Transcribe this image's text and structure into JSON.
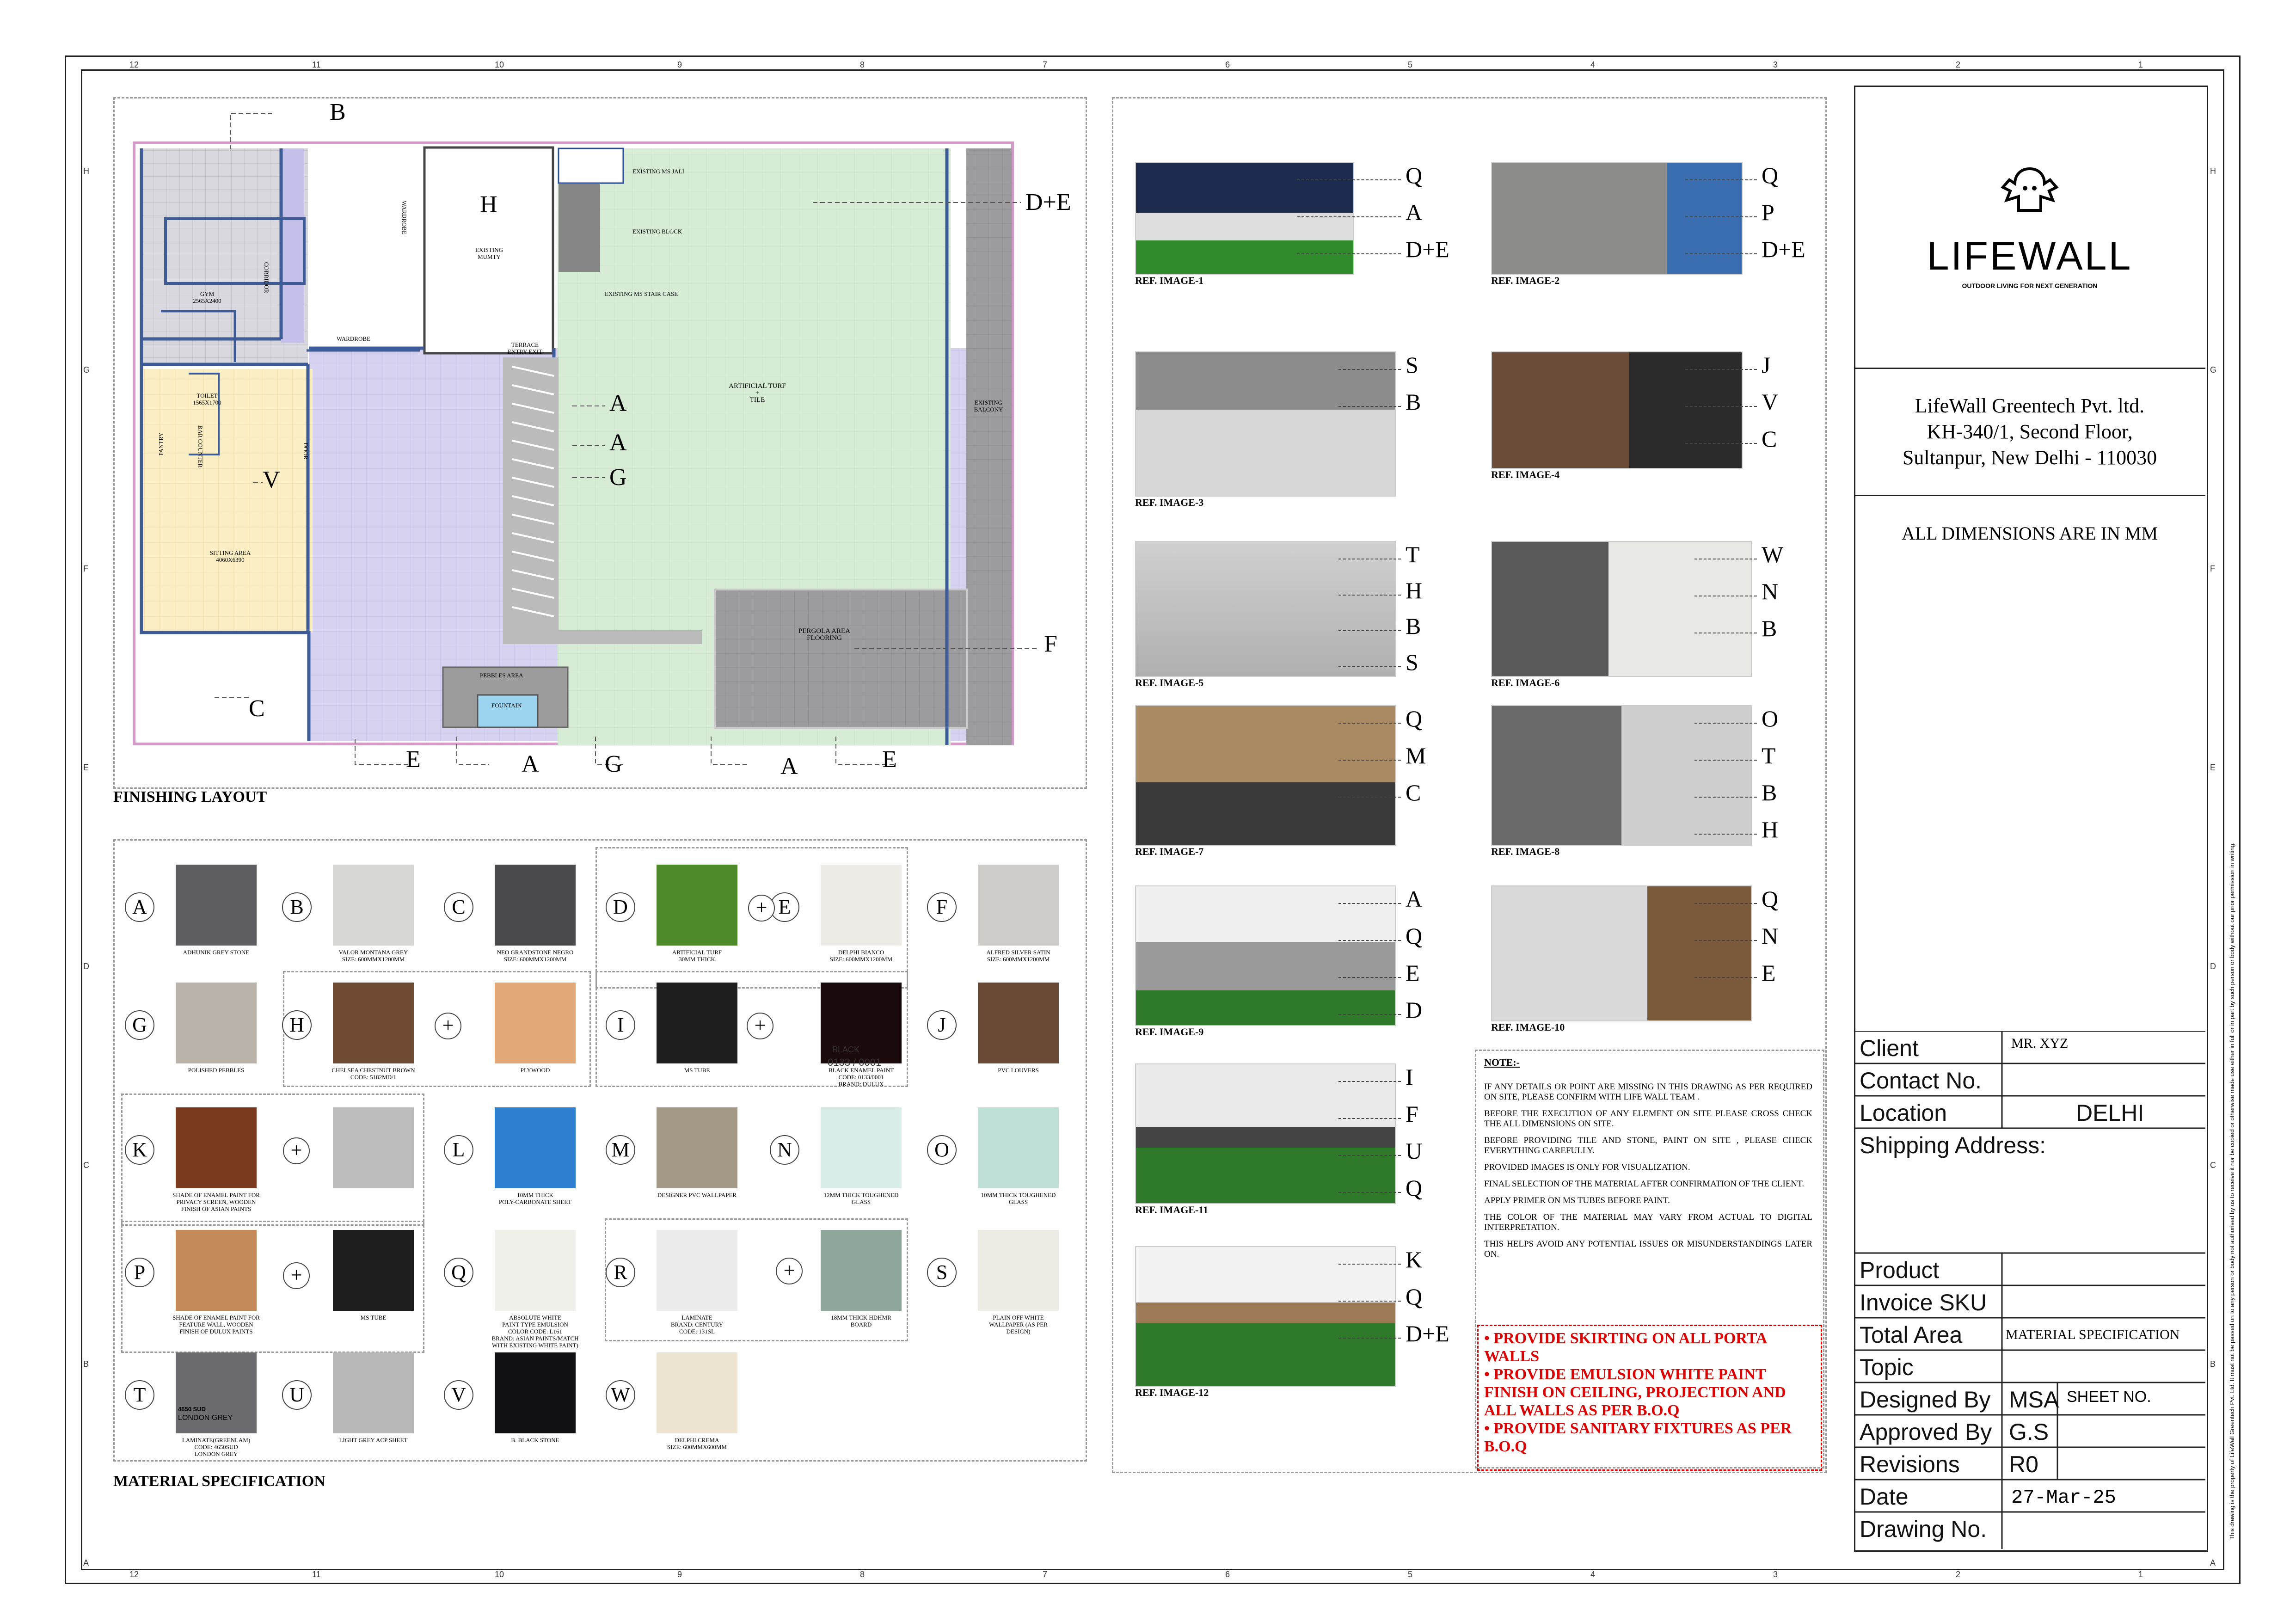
{
  "ruler": {
    "cols": [
      "12",
      "11",
      "10",
      "9",
      "8",
      "7",
      "6",
      "5",
      "4",
      "3",
      "2",
      "1"
    ],
    "rows": [
      "H",
      "G",
      "F",
      "E",
      "D",
      "C",
      "B",
      "A"
    ]
  },
  "plan": {
    "title": "FINISHING LAYOUT",
    "markers": [
      "B",
      "H",
      "D+E",
      "A",
      "A",
      "G",
      "V",
      "C",
      "F",
      "E",
      "A",
      "G",
      "A",
      "E"
    ],
    "rooms": {
      "gym": "GYM\n2565X2400",
      "corridor": "CORRIDOR",
      "wardrobe_v": "WARDROBE",
      "wardrobe_h": "WARDROBE",
      "toilet": "TOILET\n1565X1700",
      "mumty": "EXISTING\nMUMTY",
      "jali": "EXISTING MS JALI",
      "block": "EXISTING BLOCK",
      "stair": "EXISTING MS STAIR CASE",
      "terrace": "TERRACE\nENTRY EXIT",
      "turf": "ARTIFICIAL TURF\n+\nTILE",
      "balcony": "EXISTING\nBALCONY",
      "pantry": "PANTRY",
      "bar": "BAR COUNTER",
      "door": "DOOR",
      "sitting": "SITTING AREA\n4060X6390",
      "pergola": "PERGOLA AREA\nFLOORING",
      "pebbles": "PEBBLES AREA",
      "fountain": "FOUNTAIN"
    }
  },
  "materials": {
    "title": "MATERIAL SPECIFICATION",
    "items": [
      {
        "letter": "A",
        "caption": "ADHUNIK GREY STONE",
        "color": "#5e5e62"
      },
      {
        "letter": "B",
        "caption": "VALOR MONTANA GREY\nSIZE: 600MMX1200MM",
        "color": "#d7d7d6"
      },
      {
        "letter": "C",
        "caption": "NEO GRANDSTONE NEGRO\nSIZE: 600MMX1200MM",
        "color": "#4b4a4c"
      },
      {
        "letter": "D",
        "caption": "ARTIFICIAL TURF\n30MM THICK",
        "color": "#4f8a2a"
      },
      {
        "letter": "E",
        "caption": "DELPHI BIANCO\nSIZE: 600MMX1200MM",
        "color": "#ecebe6"
      },
      {
        "letter": "F",
        "caption": "ALFRED SILVER SATIN\nSIZE: 600MMX1200MM",
        "color": "#cfcdca"
      },
      {
        "letter": "G",
        "caption": "POLISHED PEBBLES",
        "color": "#b9b3aa"
      },
      {
        "letter": "H",
        "caption": "CHELSEA CHESTNUT BROWN\nCODE: 5182MD/1",
        "color": "#6f4a33"
      },
      {
        "letter": "H2",
        "caption": "PLYWOOD",
        "color": "#e3a878"
      },
      {
        "letter": "I",
        "caption": "MS TUBE",
        "color": "#1e1e1e"
      },
      {
        "letter": "I2",
        "caption": "BLACK ENAMEL PAINT\nCODE: 0133/0001\nBRAND: DULUX",
        "color": "#1a0a0c"
      },
      {
        "letter": "J",
        "caption": "PVC LOUVERS",
        "color": "#6a4a35"
      },
      {
        "letter": "K",
        "caption": "SHADE OF ENAMEL PAINT FOR\nPRIVACY SCREEN, WOODEN\nFINISH OF ASIAN PAINTS",
        "color": "#7a3b1e"
      },
      {
        "letter": "K2",
        "caption": "",
        "color": "#bdbdbd"
      },
      {
        "letter": "L",
        "caption": "10MM THICK\nPOLY-CARBONATE SHEET",
        "color": "#2f7fd0"
      },
      {
        "letter": "M",
        "caption": "DESIGNER PVC WALLPAPER",
        "color": "#a49886"
      },
      {
        "letter": "N",
        "caption": "12MM THICK TOUGHENED\nGLASS",
        "color": "#d8ece8"
      },
      {
        "letter": "O",
        "caption": "10MM THICK TOUGHENED\nGLASS",
        "color": "#bfe0d6"
      },
      {
        "letter": "P",
        "caption": "SHADE OF ENAMEL PAINT FOR\nFEATURE WALL, WOODEN\nFINISH OF DULUX PAINTS",
        "color": "#c48a5a"
      },
      {
        "letter": "P2",
        "caption": "MS TUBE",
        "color": "#1e1e1e"
      },
      {
        "letter": "Q",
        "caption": "ABSOLUTE WHITE\nPAINT TYPE EMULSION\nCOLOR CODE: L161\nBRAND: ASIAN PAINTS/MATCH\nWITH EXISTING WHITE PAINT)",
        "color": "#f1f1ec"
      },
      {
        "letter": "R",
        "caption": "LAMINATE\nBRAND: CENTURY\nCODE: 131SL",
        "color": "#ececec"
      },
      {
        "letter": "R2",
        "caption": "18MM THICK HDHMR\nBOARD",
        "color": "#8fa79a"
      },
      {
        "letter": "S",
        "caption": "PLAIN OFF WHITE\nWALLPAPER (AS PER\nDESIGN)",
        "color": "#ecebe4"
      },
      {
        "letter": "T",
        "caption": "LAMINATE(GREENLAM)\nCODE: 4650SUD\nLONDON GREY",
        "color": "#6c6c70"
      },
      {
        "letter": "U",
        "caption": "LIGHT GREY ACP SHEET",
        "color": "#b8b8b8"
      },
      {
        "letter": "V",
        "caption": "B. BLACK STONE",
        "color": "#111114"
      },
      {
        "letter": "W",
        "caption": "DELPHI CREMA\nSIZE: 600MMX600MM",
        "color": "#ede4d2"
      }
    ],
    "swatch_texts": {
      "I2_a": "BLACK",
      "I2_b": "0133 / 0001",
      "T_a": "4650 SUD",
      "T_b": "LONDON GREY"
    }
  },
  "refs": [
    {
      "caption": "REF. IMAGE-1",
      "labels": [
        "Q",
        "A",
        "D+E"
      ]
    },
    {
      "caption": "REF. IMAGE-2",
      "labels": [
        "Q",
        "P",
        "D+E"
      ]
    },
    {
      "caption": "REF. IMAGE-3",
      "labels": [
        "S",
        "B"
      ]
    },
    {
      "caption": "REF. IMAGE-4",
      "labels": [
        "J",
        "V",
        "C"
      ]
    },
    {
      "caption": "REF. IMAGE-5",
      "labels": [
        "T",
        "H",
        "B",
        "S"
      ]
    },
    {
      "caption": "REF. IMAGE-6",
      "labels": [
        "W",
        "N",
        "B"
      ]
    },
    {
      "caption": "REF. IMAGE-7",
      "labels": [
        "Q",
        "M",
        "C"
      ]
    },
    {
      "caption": "REF. IMAGE-8",
      "labels": [
        "O",
        "T",
        "B",
        "H"
      ]
    },
    {
      "caption": "REF. IMAGE-9",
      "labels": [
        "A",
        "Q",
        "E",
        "D"
      ]
    },
    {
      "caption": "REF. IMAGE-10",
      "labels": [
        "Q",
        "N",
        "E"
      ]
    },
    {
      "caption": "REF. IMAGE-11",
      "labels": [
        "I",
        "F",
        "U",
        "Q"
      ]
    },
    {
      "caption": "REF. IMAGE-12",
      "labels": [
        "K",
        "Q",
        "D+E"
      ]
    }
  ],
  "notes": {
    "title": "NOTE:-",
    "items": [
      "IF ANY DETAILS OR POINT ARE MISSING IN THIS DRAWING AS PER REQUIRED ON SITE, PLEASE CONFIRM WITH LIFE WALL TEAM .",
      "BEFORE THE EXECUTION OF ANY ELEMENT ON SITE PLEASE CROSS CHECK THE ALL DIMENSIONS ON SITE.",
      "BEFORE PROVIDING TILE AND STONE, PAINT ON SITE , PLEASE CHECK EVERYTHING CAREFULLY.",
      "PROVIDED IMAGES IS ONLY FOR VISUALIZATION.",
      "FINAL SELECTION OF THE MATERIAL AFTER CONFIRMATION OF THE CLIENT.",
      "APPLY PRIMER ON MS TUBES BEFORE PAINT.",
      "THE COLOR OF THE MATERIAL MAY VARY FROM ACTUAL TO DIGITAL INTERPRETATION.",
      "THIS HELPS AVOID ANY POTENTIAL ISSUES OR MISUNDERSTANDINGS LATER ON."
    ],
    "red_items": [
      "PROVIDE SKIRTING ON ALL PORTA WALLS",
      "PROVIDE EMULSION WHITE PAINT FINISH ON CEILING, PROJECTION AND ALL WALLS AS PER B.O.Q",
      "PROVIDE SANITARY FIXTURES AS PER B.O.Q"
    ]
  },
  "titleblock": {
    "logo_text": "LIFEWALL",
    "tagline": "OUTDOOR LIVING FOR NEXT GENERATION",
    "company": "LifeWall Greentech Pvt. ltd.",
    "address1": "KH-340/1, Second Floor,",
    "address2": "Sultanpur, New Delhi - 110030",
    "dims_note": "ALL DIMENSIONS ARE IN MM",
    "client_label": "Client",
    "client": "MR. XYZ",
    "contact_label": "Contact No.",
    "contact": "",
    "location_label": "Location",
    "location": "DELHI",
    "shipping_label": "Shipping Address:",
    "product_label": "Product",
    "invoice_label": "Invoice SKU",
    "area_label": "Total Area",
    "sheet_title": "MATERIAL SPECIFICATION",
    "topic_label": "Topic",
    "designed_label": "Designed By",
    "designed": "MSA",
    "sheet_no_label": "SHEET NO.",
    "approved_label": "Approved By",
    "approved": "G.S",
    "revisions_label": "Revisions",
    "revisions": "R0",
    "date_label": "Date",
    "date": "27-Mar-25",
    "drawing_label": "Drawing No.",
    "side_disclaimer": "This drawing is the property of LifeWall Greentech Pvt. Ltd. It must not be passed on to any person or body not authorised by us to receive it nor be copied or otherwise made use either in full or in part by such person or body without our prior permission in writing."
  }
}
